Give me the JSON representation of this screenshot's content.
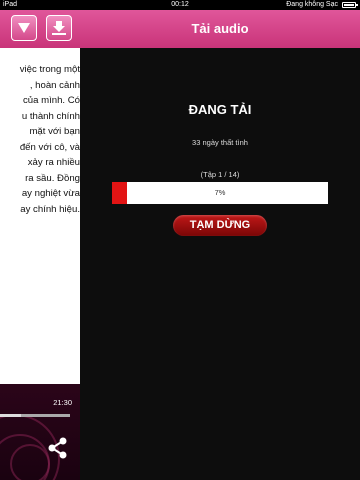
{
  "statusbar": {
    "carrier": "iPad",
    "time": "00:12",
    "charge_text": "Đang không Sạc"
  },
  "reader": {
    "lines": [
      "việc trong một",
      ", hoàn cảnh",
      "của mình. Có",
      "u thành chính",
      "mặt với bạn",
      "đến với cô, và",
      "xảy ra nhiều",
      "ra sầu. Đồng",
      "ay nghiệt vừa",
      "ay chính hiệu."
    ],
    "time": "21:30",
    "icons": {
      "collapse": "chevron-down-icon",
      "download": "download-icon",
      "share": "share-icon"
    },
    "playback_progress": 0.3
  },
  "panel": {
    "title": "Tải audio",
    "status": "ĐANG TẢI",
    "book_title": "33 ngày thất tình",
    "episode": "(Tập 1 / 14)",
    "progress_label": "7%",
    "progress_value": 7,
    "pause_label": "TẠM DỪNG"
  },
  "colors": {
    "accent": "#d4478a",
    "progress": "#e21414",
    "pause": "#a10f0f"
  }
}
